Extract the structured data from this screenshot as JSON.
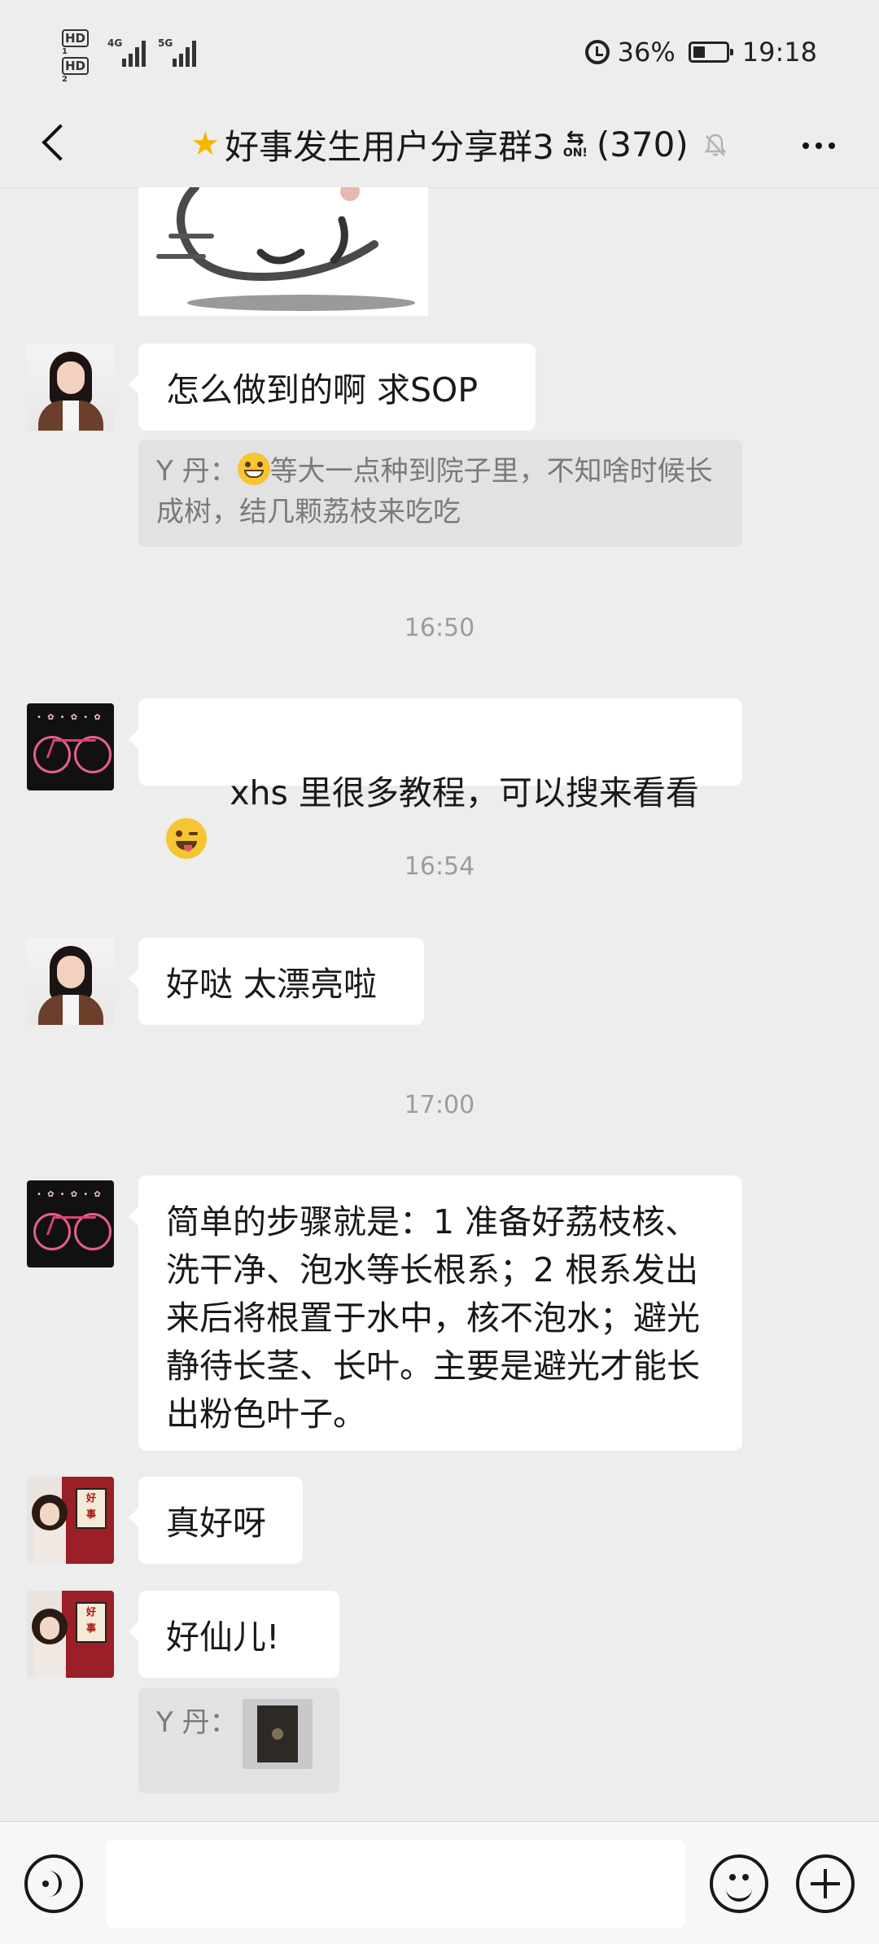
{
  "status_bar": {
    "hd1": "HD",
    "hd1_sub": "1",
    "hd2": "HD",
    "hd2_sub": "2",
    "net1": "4G",
    "net2": "5G",
    "battery": "36%",
    "battery_level": 0.36,
    "time": "19:18"
  },
  "header": {
    "title": "好事发生用户分享群3",
    "count": "(370)",
    "badge_text": "ON!"
  },
  "messages": [
    {
      "text": "怎么做到的啊 求SOP"
    },
    {
      "quote_sender": "Y 丹：",
      "quote_text": "等大一点种到院子里，不知啥时候长成树，结几颗荔枝来吃吃"
    },
    {
      "time": "16:50"
    },
    {
      "text": "xhs 里很多教程，可以搜来看看"
    },
    {
      "time": "16:54"
    },
    {
      "text": "好哒 太漂亮啦"
    },
    {
      "time": "17:00"
    },
    {
      "text": "简单的步骤就是：1 准备好荔枝核、洗干净、泡水等长根系；2 根系发出来后将根置于水中，核不泡水；避光静待长茎、长叶。主要是避光才能长出粉色叶子。"
    },
    {
      "text": "真好呀"
    },
    {
      "text": "好仙儿!"
    },
    {
      "quote_sender": "Y 丹："
    }
  ],
  "colors": {
    "background": "#ededed",
    "bubble": "#ffffff",
    "quote_bg": "#e2e2e2",
    "time_text": "#9c9c9c"
  }
}
